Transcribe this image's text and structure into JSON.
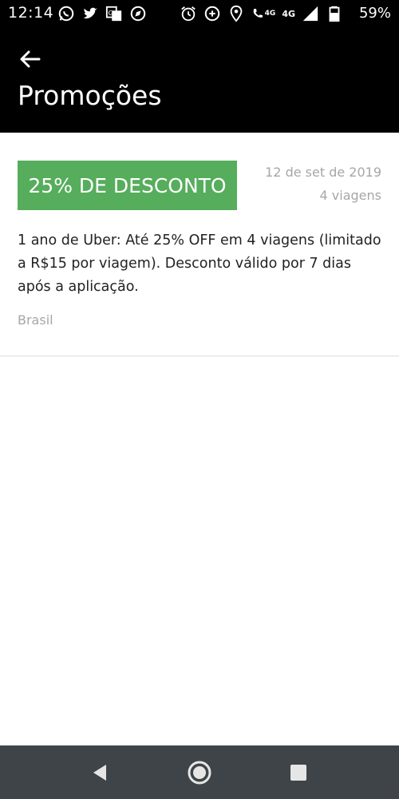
{
  "status_bar": {
    "time": "12:14",
    "network_label": "4G",
    "network_label_small": "4G",
    "battery_percent": "59%",
    "icons": [
      "whatsapp-icon",
      "twitter-icon",
      "translate-icon",
      "compass-icon",
      "alarm-icon",
      "data-saver-icon",
      "location-icon",
      "call-icon",
      "signal-icon",
      "battery-icon"
    ]
  },
  "header": {
    "title": "Promoções",
    "back_icon": "arrow-left-icon"
  },
  "promotion": {
    "badge": "25% DE DESCONTO",
    "badge_color": "#56ad5c",
    "date": "12 de set de 2019",
    "trips": "4 viagens",
    "description": "1 ano de Uber: Até 25% OFF em 4 viagens (limitado a R$15 por viagem). Desconto válido por 7 dias após a aplicação.",
    "region": "Brasil"
  },
  "navigation": {
    "icons": [
      "back-triangle-icon",
      "home-circle-icon",
      "recents-square-icon"
    ]
  }
}
